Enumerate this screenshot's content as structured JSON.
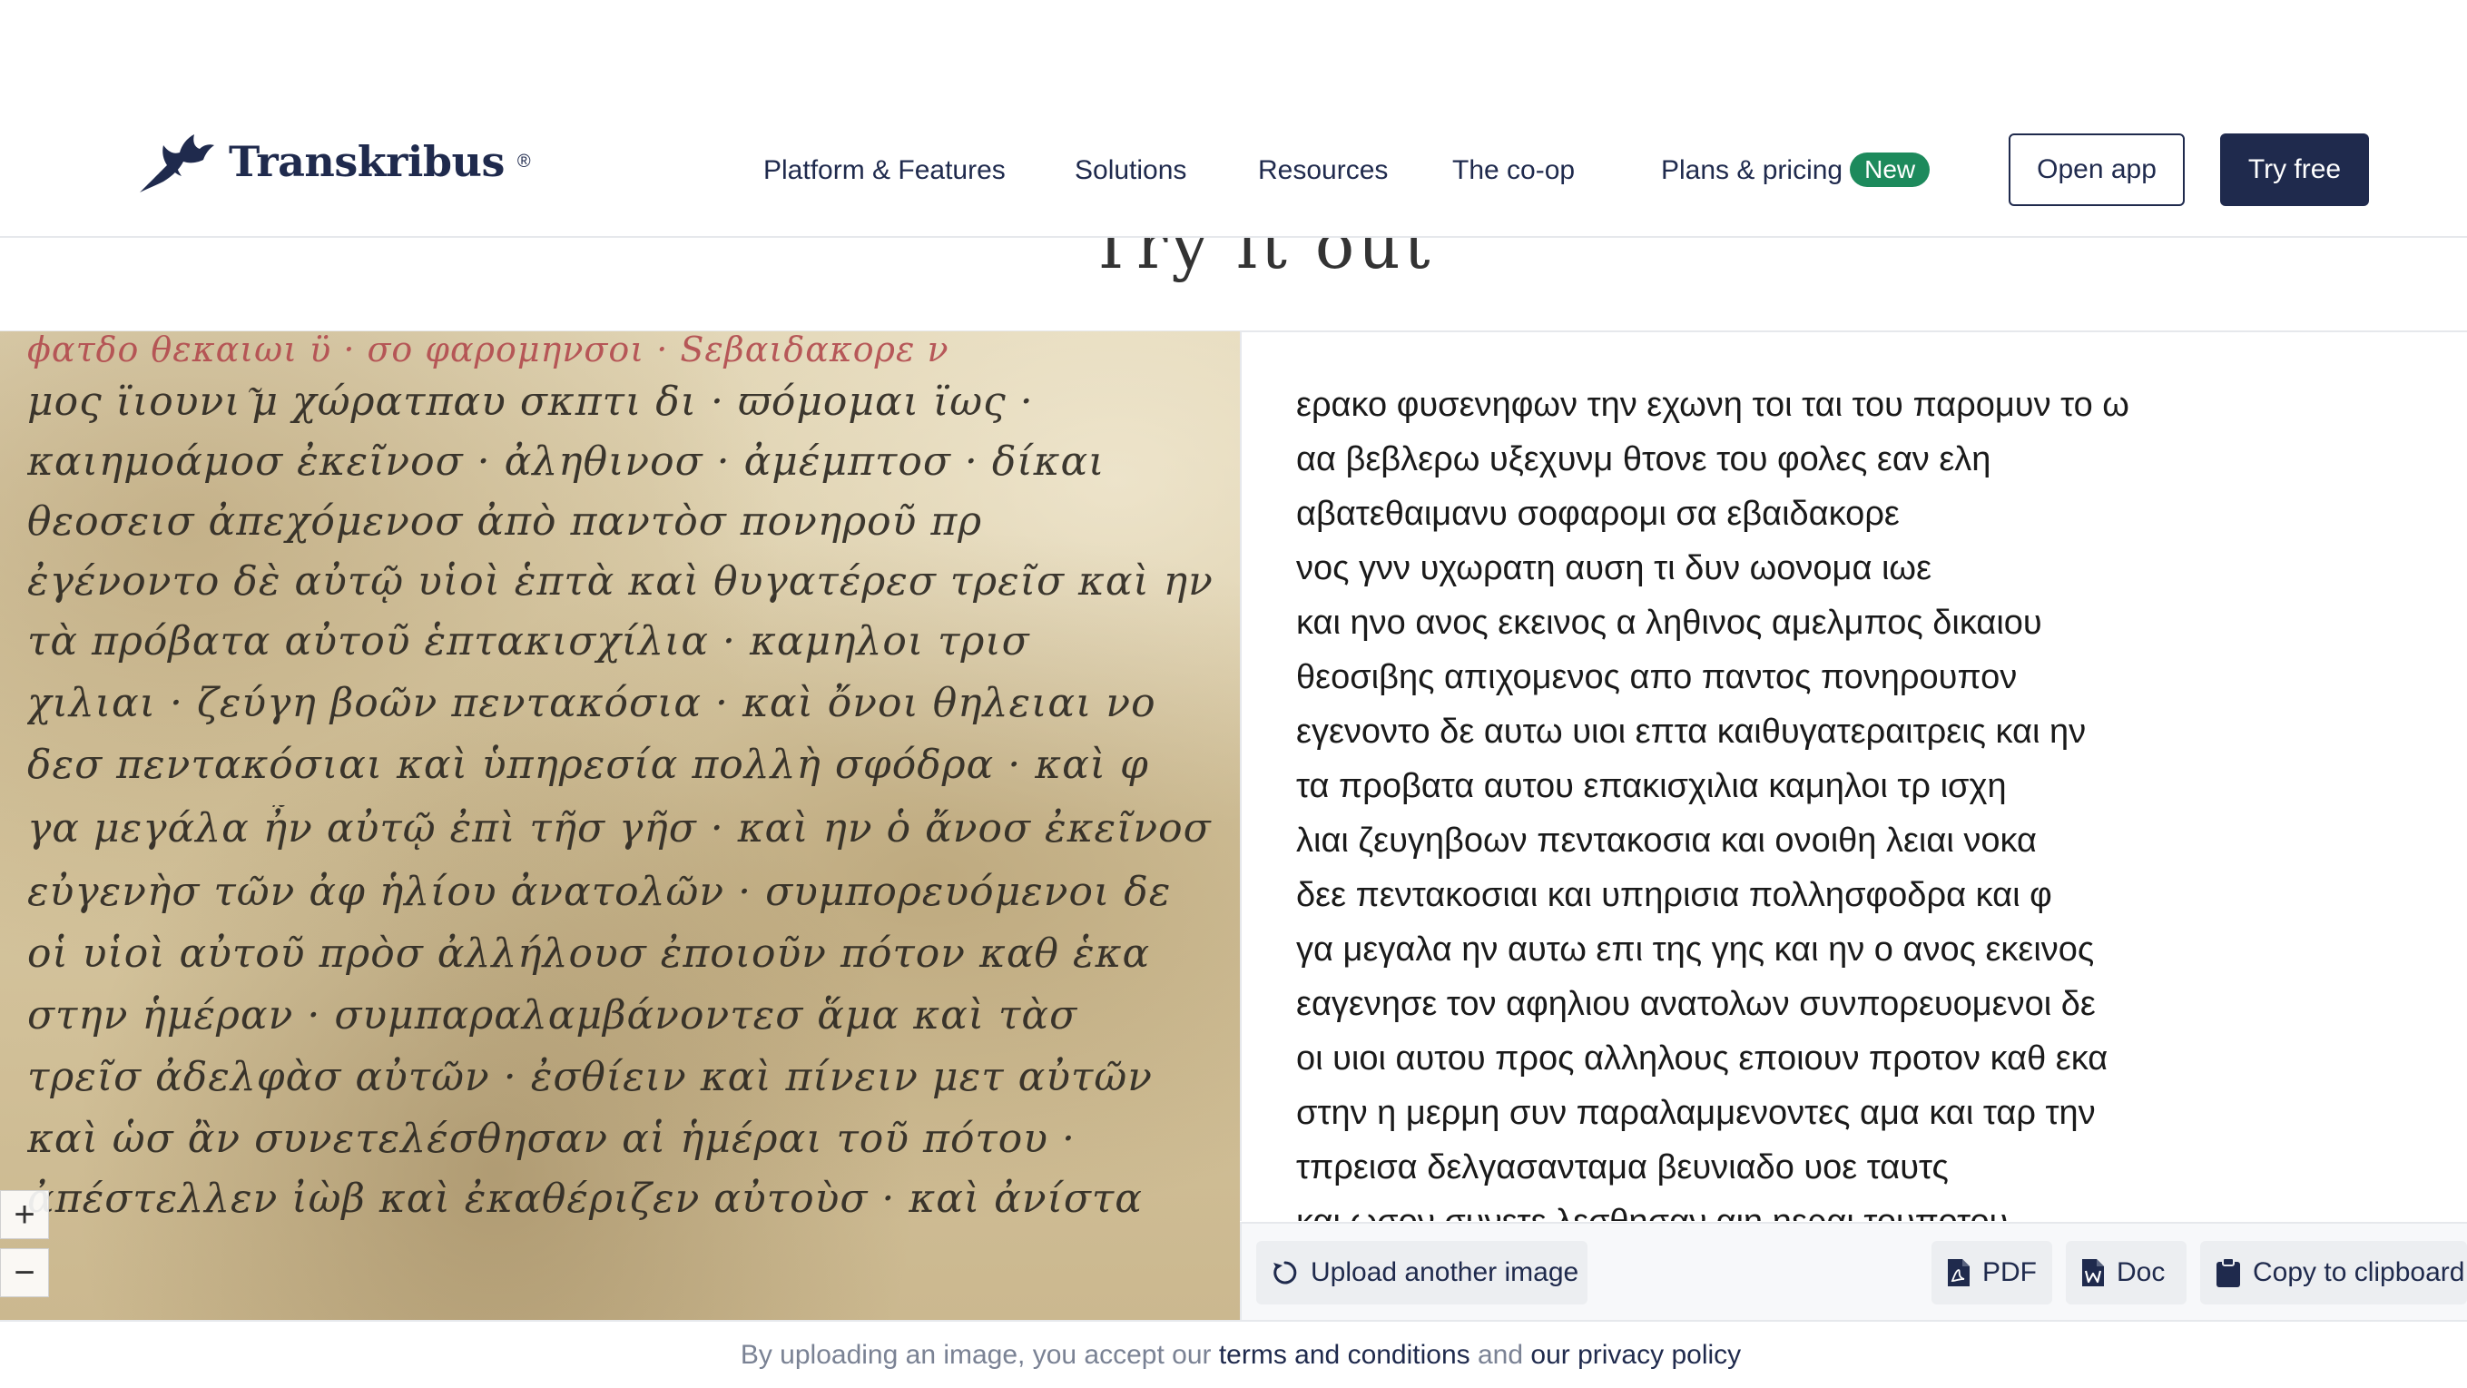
{
  "header": {
    "logo_text": "Transkribus",
    "logo_reg": "®",
    "nav": [
      {
        "label": "Platform & Features"
      },
      {
        "label": "Solutions"
      },
      {
        "label": "Resources"
      },
      {
        "label": "The co-op"
      },
      {
        "label": "Plans & pricing",
        "badge": "New"
      }
    ],
    "open_app": "Open app",
    "try_free": "Try free"
  },
  "page_title_fragment": "Try it out",
  "manuscript": {
    "lines": [
      "ϕατδο θεκαιωι ϋ · σο φαρομηνσοι · Sεβαιδακορε ν",
      "μος ϊιουνι ͂μ χώρατπαυ σκπτι δι · ϖόμομαι ϊως ·",
      "καιημοάμοσ ἐκεῖνοσ · ἀληθινοσ · ἀμέμπτοσ · δίκαι",
      "θεοσεισ ἀπεχόμενοσ ἀπὸ παντὸσ πονηροῦ πρ",
      "ἐγένοντο δὲ αὐτῷ υἱοὶ ἑπτὰ καὶ θυγατέρεσ τρεῖσ καὶ ην",
      "τὰ πρόβατα αὐτοῦ ἑπτακισχίλια · καμηλοι τρισ",
      "χιλιαι · ζεύγη βοῶν πεντακόσια · καὶ ὄνοι θηλειαι νο",
      "δεσ πεντακόσιαι καὶ ὑπηρεσία πολλὴ σφόδρα · καὶ φ",
      "γα μεγάλα ἦν αὐτῷ ἐπὶ τῆσ γῆσ · καὶ ην ὁ ἄνοσ ἐκεῖνοσ",
      "εὐγενὴσ τῶν ἀφ ἡλίου ἀνατολῶν · συμπορευόμενοι δε",
      "οἱ υἱοὶ αὐτοῦ πρὸσ ἀλλήλουσ ἐποιοῦν πότον καθ ἑκα",
      "στην ἡμέραν · συμπαραλαμβάνοντεσ ἅμα καὶ τὰσ",
      "τρεῖσ ἀδελφὰσ αὐτῶν · ἐσθίειν καὶ πίνειν μετ αὐτῶν",
      "καὶ ὡσ ἂν συνετελέσθησαν αἱ ἡμέραι τοῦ πότου ·",
      "ἀπέστελλεν ἰὼβ καὶ ἐκαθέριζεν αὐτοὺσ · καὶ ἀνίστα"
    ],
    "zoom_in": "+",
    "zoom_out": "−"
  },
  "transcription": {
    "lines": [
      "ερακο φυσενηφων την εχωνη τοι ται του παρομυν το ω",
      "αα βεβλερω υξεχυνμ θτονε του φολες εαν ελη",
      "αβατεθαιμανυ σοφαρομι σα εβαιδακορε",
      "νος γνν υχωρατη αυση τι δυν ωονομα ιωε",
      "και ηνο ανος εκεινος α ληθινος αμελμπος δικαιου",
      "θεοσιβης απιχομενος απο παντος πονηρουπον",
      "εγενοντο δε αυτω υιοι επτα καιθυγατεραιτρεις και ην",
      "τα προβατα αυτου επακισχιλια καμηλοι τρ ισχη",
      "λιαι ζευγηβοων πεντακοσια και ονοιθη λειαι νοκα",
      "δεε πεντακοσιαι και υπηρισια πολλησφοδρα και φ",
      "γα μεγαλα ην αυτω επι της γης και ην ο ανος εκεινος",
      "εαγενησε τον αφηλιου ανατολων συνπορευομενοι δε",
      "οι υιοι αυτου προς αλληλους εποιουν προτον καθ εκα",
      "στην η μερμη συν παραλαμμενοντες αμα και ταρ την",
      "τπρεισα δελγασανταμα βευνιαδο υοε ταυτς",
      "και ωσον συνετε λεσθησαν αιη ηεραι τουποτου"
    ]
  },
  "toolbar": {
    "upload": "Upload another image",
    "pdf": "PDF",
    "doc": "Doc",
    "copy": "Copy to clipboard"
  },
  "consent": {
    "prefix": "By uploading an image, you accept our ",
    "terms": "terms and conditions",
    "and": " and ",
    "privacy": "our privacy policy"
  },
  "colors": {
    "brand_navy": "#1f2a4d",
    "badge_green": "#1d8a5c",
    "muted_text": "#7a8294"
  }
}
